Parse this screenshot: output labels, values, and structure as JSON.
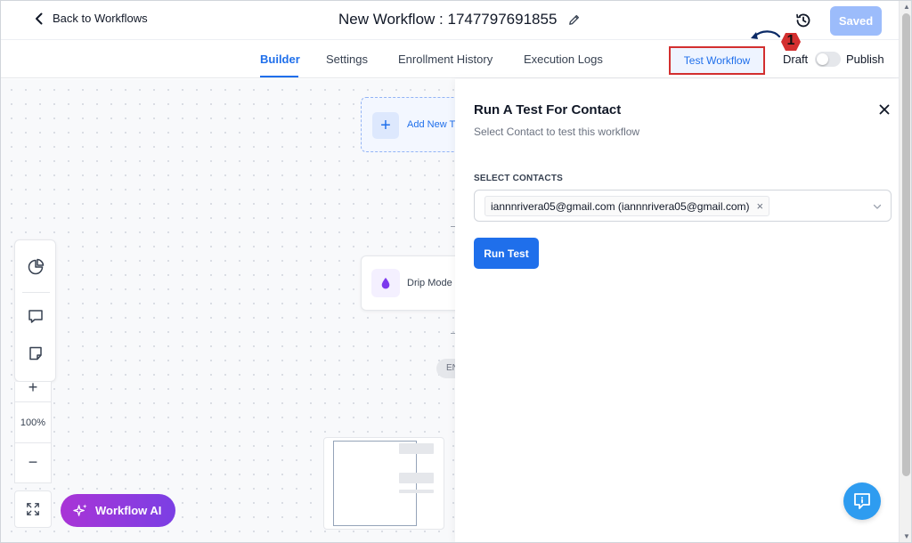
{
  "header": {
    "back_label": "Back to Workflows",
    "workflow_title": "New Workflow : 1747797691855",
    "saved_label": "Saved"
  },
  "tabs": [
    {
      "label": "Builder",
      "active": true
    },
    {
      "label": "Settings",
      "active": false
    },
    {
      "label": "Enrollment History",
      "active": false
    },
    {
      "label": "Execution Logs",
      "active": false
    }
  ],
  "actions": {
    "test_workflow_label": "Test Workflow",
    "draft_label": "Draft",
    "publish_label": "Publish",
    "publish_enabled": false
  },
  "annotation": {
    "step_number": "1",
    "color": "#d32f2f"
  },
  "canvas": {
    "add_trigger_label": "Add New Tr",
    "drip_node_label": "Drip Mode",
    "end_label": "EN",
    "zoom_in_symbol": "+",
    "zoom_out_symbol": "−",
    "zoom_level": "100%",
    "ai_button_label": "Workflow AI"
  },
  "panel": {
    "title": "Run A Test For Contact",
    "subtitle": "Select Contact to test this workflow",
    "field_label": "SELECT CONTACTS",
    "selected_contact": "iannnrivera05@gmail.com (iannnrivera05@gmail.com)",
    "chip_remove_symbol": "×",
    "run_button_label": "Run Test"
  },
  "colors": {
    "primary": "#1f6feb",
    "saved_disabled": "#9cbcfb",
    "ai_gradient_start": "#a934d6",
    "ai_gradient_end": "#7b3fe4",
    "chat_bubble": "#2e9cf0"
  }
}
